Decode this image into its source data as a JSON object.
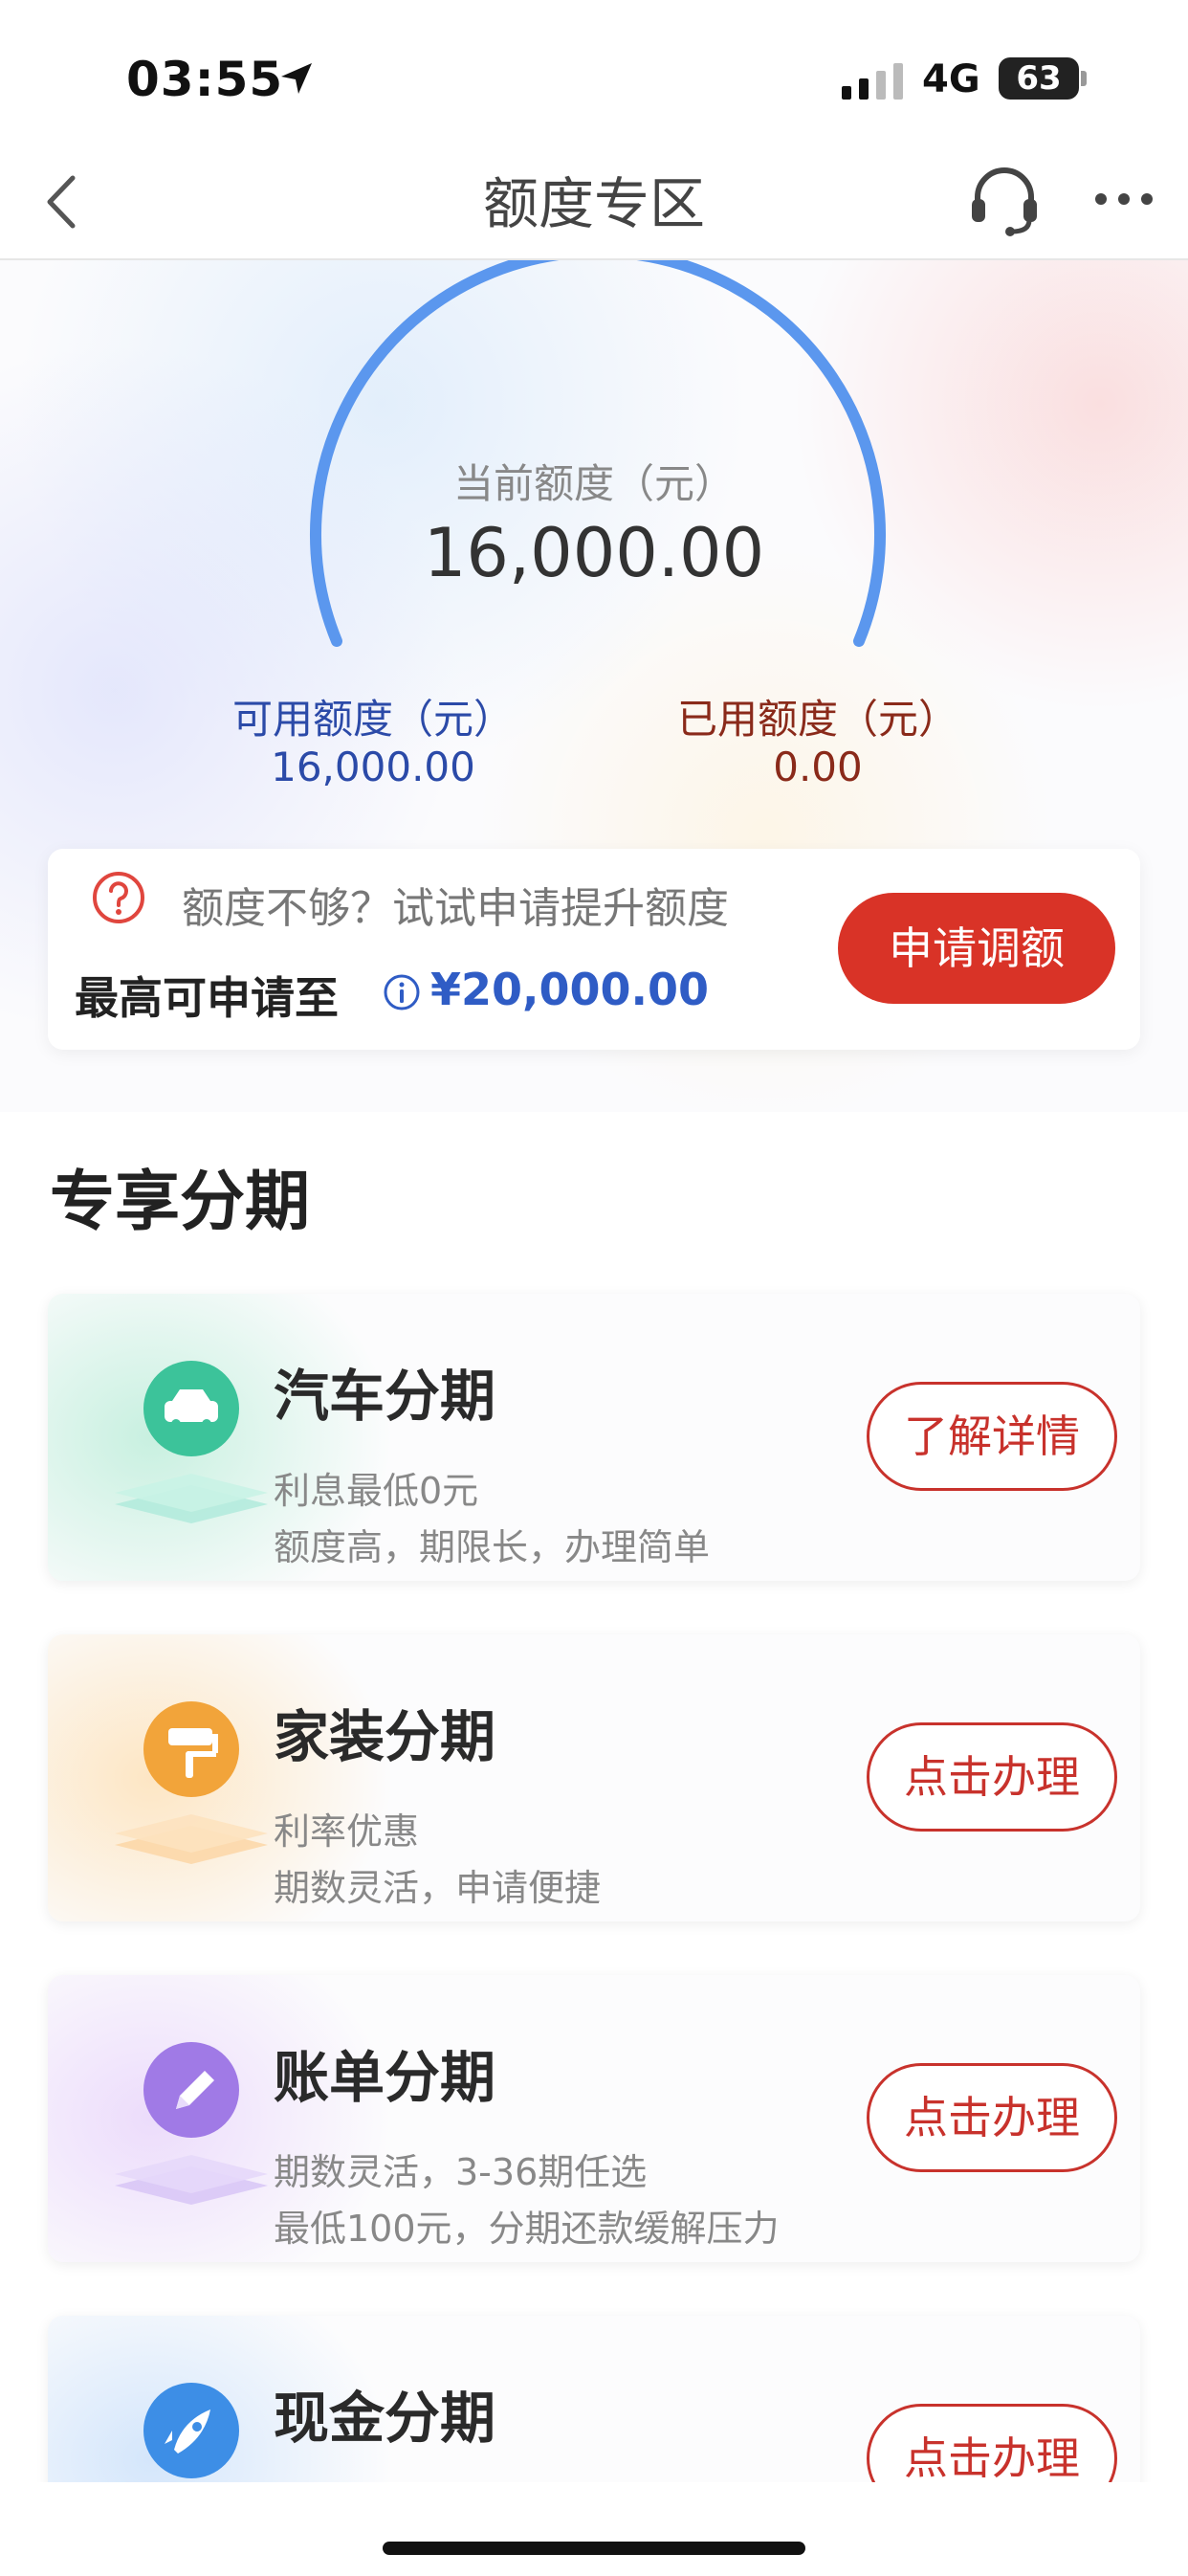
{
  "status_bar": {
    "time": "03:55",
    "network": "4G",
    "battery": "63"
  },
  "nav": {
    "title": "额度专区"
  },
  "hero": {
    "current_limit_label": "当前额度（元）",
    "current_limit_value": "16,000.00",
    "available_label": "可用额度（元）",
    "available_value": "16,000.00",
    "used_label": "已用额度（元）",
    "used_value": "0.00",
    "raise": {
      "hint": "额度不够？试试申请提升额度",
      "max_label": "最高可申请至",
      "max_value": "¥20,000.00",
      "apply_label": "申请调额"
    }
  },
  "section": {
    "title": "专享分期"
  },
  "cards": [
    {
      "title": "汽车分期",
      "line1": "利息最低0元",
      "line2": "额度高，期限长，办理简单",
      "button": "了解详情",
      "icon": "car-icon",
      "color": "#3cc39a"
    },
    {
      "title": "家装分期",
      "line1": "利率优惠",
      "line2": "期数灵活，申请便捷",
      "button": "点击办理",
      "icon": "paint-roller-icon",
      "color": "#f2a43a"
    },
    {
      "title": "账单分期",
      "line1": "期数灵活，3-36期任选",
      "line2": "最低100元，分期还款缓解压力",
      "button": "点击办理",
      "icon": "pen-icon",
      "color": "#a07ae6"
    },
    {
      "title": "现金分期",
      "line1": "",
      "line2": "",
      "button": "点击办理",
      "icon": "rocket-icon",
      "color": "#3d8ee6"
    }
  ],
  "colors": {
    "accent_red": "#d93327",
    "accent_blue": "#2f5cc5",
    "gauge_blue": "#5b97ee"
  }
}
